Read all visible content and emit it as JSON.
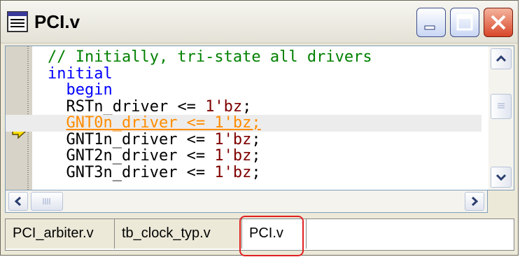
{
  "window": {
    "title": "PCI.v",
    "icons": {
      "doc": "document-icon",
      "minimize": "minimize-icon",
      "maximize": "maximize-icon",
      "close": "close-icon"
    }
  },
  "editor": {
    "lines": [
      {
        "indent": "",
        "parts": [
          {
            "cls": "c-comment",
            "text": "// Initially, tri-state all drivers"
          }
        ]
      },
      {
        "indent": "",
        "parts": [
          {
            "cls": "c-kw",
            "text": "initial"
          }
        ]
      },
      {
        "indent": "  ",
        "parts": [
          {
            "cls": "c-kw",
            "text": "begin"
          }
        ]
      },
      {
        "indent": "  ",
        "parts": [
          {
            "cls": "c-id",
            "text": "RSTn_driver <= "
          },
          {
            "cls": "c-num",
            "text": "1'bz"
          },
          {
            "cls": "c-id",
            "text": ";"
          }
        ]
      },
      {
        "indent": "  ",
        "highlight": true,
        "parts": [
          {
            "cls": "c-id",
            "text": "GNT0n_driver <= 1'bz;"
          }
        ]
      },
      {
        "indent": "  ",
        "parts": [
          {
            "cls": "c-id",
            "text": "GNT1n_driver <= "
          },
          {
            "cls": "c-num",
            "text": "1'bz"
          },
          {
            "cls": "c-id",
            "text": ";"
          }
        ]
      },
      {
        "indent": "  ",
        "parts": [
          {
            "cls": "c-id",
            "text": "GNT2n_driver <= "
          },
          {
            "cls": "c-num",
            "text": "1'bz"
          },
          {
            "cls": "c-id",
            "text": ";"
          }
        ]
      },
      {
        "indent": "  ",
        "parts": [
          {
            "cls": "c-id",
            "text": "GNT3n_driver <= "
          },
          {
            "cls": "c-num",
            "text": "1'bz"
          },
          {
            "cls": "c-id",
            "text": ";"
          }
        ]
      }
    ],
    "current_line_marker": "current-line-arrow-icon"
  },
  "tabs": [
    {
      "label": "PCI_arbiter.v",
      "active": false
    },
    {
      "label": "tb_clock_typ.v",
      "active": false
    },
    {
      "label": "PCI.v",
      "active": true
    }
  ],
  "colors": {
    "comment": "#008000",
    "keyword": "#0000ff",
    "number": "#800000",
    "current_line": "#ff8c00",
    "tab_highlight": "#e02020"
  }
}
